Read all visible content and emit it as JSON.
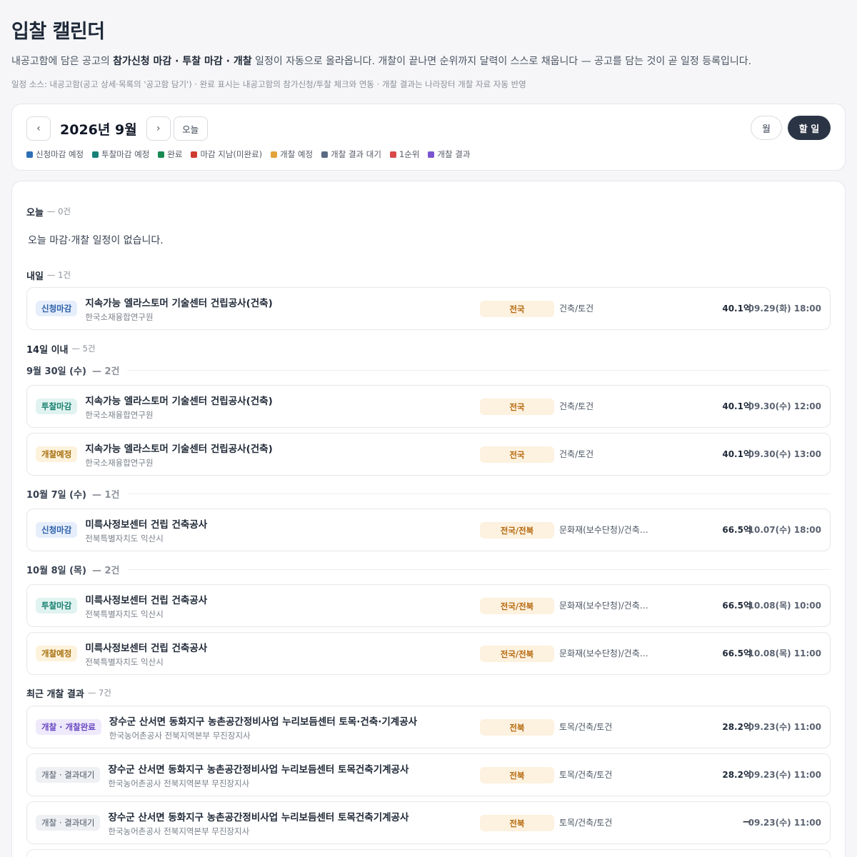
{
  "page": {
    "title": "입찰 캘린더",
    "desc_before": "내공고함에 담은 공고의 ",
    "desc_bold1": "참가신청 마감 · 투찰 마감 · 개찰",
    "desc_after": " 일정이 자동으로 올라옵니다. 개찰이 끝나면 순위까지 달력이 스스로 채웁니다 — 공고를 담는 것이 곧 일정 등록입니다.",
    "source": "일정 소스: 내공고함(공고 상세·목록의 '공고함 담기') · 완료 표시는 내공고함의 참가신청/투찰 체크와 연동 · 개찰 결과는 나라장터 개찰 자료 자동 반영"
  },
  "toolbar": {
    "prev": "‹",
    "next": "›",
    "month": "2026년 9월",
    "today": "오늘",
    "view_month": "월",
    "view_todo": "할 일"
  },
  "legend": [
    {
      "label": "신청마감 예정",
      "color": "#2f6fb5"
    },
    {
      "label": "투찰마감 예정",
      "color": "#168276"
    },
    {
      "label": "완료",
      "color": "#178a52"
    },
    {
      "label": "마감 지남(미완료)",
      "color": "#cf3b30"
    },
    {
      "label": "개찰 예정",
      "color": "#e0a43a"
    },
    {
      "label": "개찰 결과 대기",
      "color": "#5b6b82"
    },
    {
      "label": "1순위",
      "color": "#d84848"
    },
    {
      "label": "개찰 결과",
      "color": "#7b55d1"
    }
  ],
  "today_section": {
    "label": "오늘",
    "count": "— 0건",
    "empty": "오늘 마감·개찰 일정이 없습니다."
  },
  "tomorrow_section": {
    "label": "내일",
    "count": "— 1건"
  },
  "within14_section": {
    "label": "14일 이내",
    "count": "— 5건"
  },
  "recent_section": {
    "label": "최근 개찰 결과",
    "count": "— 7건"
  },
  "date_groups": [
    {
      "label": "9월 30일 (수)",
      "count": "— 2건"
    },
    {
      "label": "10월 7일 (수)",
      "count": "— 1건"
    },
    {
      "label": "10월 8일 (목)",
      "count": "— 2건"
    }
  ],
  "rows": [
    {
      "badge": "신청마감",
      "title": "지속가능 엘라스토머 기술센터 건립공사(건축)",
      "org": "한국소재융합연구원",
      "region": "전국",
      "category": "건축/토건",
      "amount": "40.1억",
      "datetime": "09.29(화) 18:00"
    },
    {
      "badge": "투찰마감",
      "title": "지속가능 엘라스토머 기술센터 건립공사(건축)",
      "org": "한국소재융합연구원",
      "region": "전국",
      "category": "건축/토건",
      "amount": "40.1억",
      "datetime": "09.30(수) 12:00"
    },
    {
      "badge": "개찰예정",
      "title": "지속가능 엘라스토머 기술센터 건립공사(건축)",
      "org": "한국소재융합연구원",
      "region": "전국",
      "category": "건축/토건",
      "amount": "40.1억",
      "datetime": "09.30(수) 13:00"
    },
    {
      "badge": "신청마감",
      "title": "미륵사정보센터 건립 건축공사",
      "org": "전북특별자치도 익산시",
      "region": "전국/전북",
      "category": "문화재(보수단청)/건축…",
      "amount": "66.5억",
      "datetime": "10.07(수) 18:00"
    },
    {
      "badge": "투찰마감",
      "title": "미륵사정보센터 건립 건축공사",
      "org": "전북특별자치도 익산시",
      "region": "전국/전북",
      "category": "문화재(보수단청)/건축…",
      "amount": "66.5억",
      "datetime": "10.08(목) 10:00"
    },
    {
      "badge": "개찰예정",
      "title": "미륵사정보센터 건립 건축공사",
      "org": "전북특별자치도 익산시",
      "region": "전국/전북",
      "category": "문화재(보수단청)/건축…",
      "amount": "66.5억",
      "datetime": "10.08(목) 11:00"
    },
    {
      "badge": "개찰 · 개찰완료",
      "title": "장수군 산서면 동화지구 농촌공간정비사업 누리보듬센터 토목·건축·기계공사",
      "org": "한국농어촌공사 전북지역본부 무진장지사",
      "region": "전북",
      "category": "토목/건축/토건",
      "amount": "28.2억",
      "datetime": "09.23(수) 11:00"
    },
    {
      "badge": "개찰 · 결과대기",
      "title": "장수군 산서면 동화지구 농촌공간정비사업 누리보듬센터 토목건축기계공사",
      "org": "한국농어촌공사 전북지역본부 무진장지사",
      "region": "전북",
      "category": "토목/건축/토건",
      "amount": "28.2억",
      "datetime": "09.23(수) 11:00"
    },
    {
      "badge": "개찰 · 결과대기",
      "title": "장수군 산서면 동화지구 농촌공간정비사업 누리보듬센터 토목건축기계공사",
      "org": "한국농어촌공사 전북지역본부 무진장지사",
      "region": "전북",
      "category": "토목/건축/토건",
      "amount": "—",
      "datetime": "09.23(수) 11:00"
    }
  ]
}
